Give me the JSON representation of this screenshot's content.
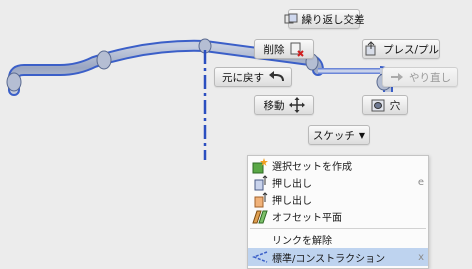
{
  "toolbar": {
    "repeat_intersect": "繰り返し交差",
    "delete": "削除",
    "press_pull": "プレス/プル",
    "undo": "元に戻す",
    "redo": "やり直し",
    "move": "移動",
    "hole": "穴",
    "sketch": "スケッチ"
  },
  "menu": {
    "items": [
      {
        "label": "選択セットを作成",
        "shortcut": "",
        "icon": "selection-set-icon"
      },
      {
        "label": "押し出し",
        "shortcut": "e",
        "icon": "extrude-icon"
      },
      {
        "label": "押し出し",
        "shortcut": "",
        "icon": "extrude-icon"
      },
      {
        "label": "オフセット平面",
        "shortcut": "",
        "icon": "offset-plane-icon"
      }
    ],
    "unlink": "リンクを解除",
    "construction": {
      "label": "標準/コンストラクション",
      "shortcut": "x"
    }
  },
  "colors": {
    "pipe_stroke": "#3b5fc8",
    "pipe_fill": "#a8b4d0",
    "highlight": "#bed3ef"
  }
}
